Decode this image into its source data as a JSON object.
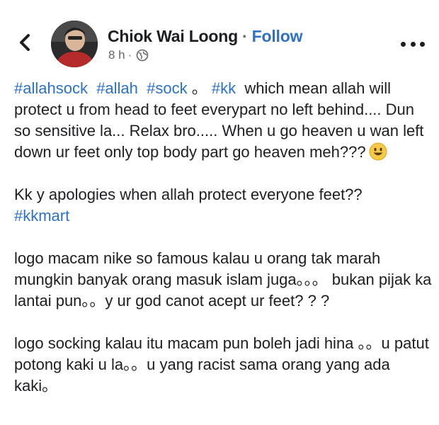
{
  "post": {
    "author": "Chiok Wai Loong",
    "separator": "·",
    "follow_label": "Follow",
    "time": "8 h",
    "time_separator": "·",
    "visibility_icon": "globe-icon",
    "back_icon": "chevron-left-icon",
    "more_icon": "more-horizontal-icon",
    "paragraph_1": {
      "tag_1": "#allahsock",
      "tag_2": "#allah",
      "tag_3": "#sock",
      "sep": "。",
      "tag_4": "#kk",
      "text": "which mean allah will protect u from head to feet everypart no left behind.... Dun so sensitive la... Relax bro..... When u go heaven u wan left down ur feet only top body part go heaven meh???",
      "emoji": "smile-emoji"
    },
    "paragraph_2": {
      "text": "Kk y apologies when allah protect everyone feet??",
      "tag": "#kkmart"
    },
    "paragraph_3": {
      "text": "logo macam nike so famous kalau u orang tak marah mungkin banyak orang masuk islam juga。。。 bukan pijak ka lantai pun。。y ur god canot acept ur feet? ? ?"
    },
    "paragraph_4": {
      "text": "logo socking kalau itu macam pun boleh jadi hina 。。u patut potong kaki u la。。u yang racist sama orang yang ada kaki。"
    }
  },
  "colors": {
    "link": "#2d72c4",
    "text": "#1c1e21",
    "meta": "#65676b"
  }
}
